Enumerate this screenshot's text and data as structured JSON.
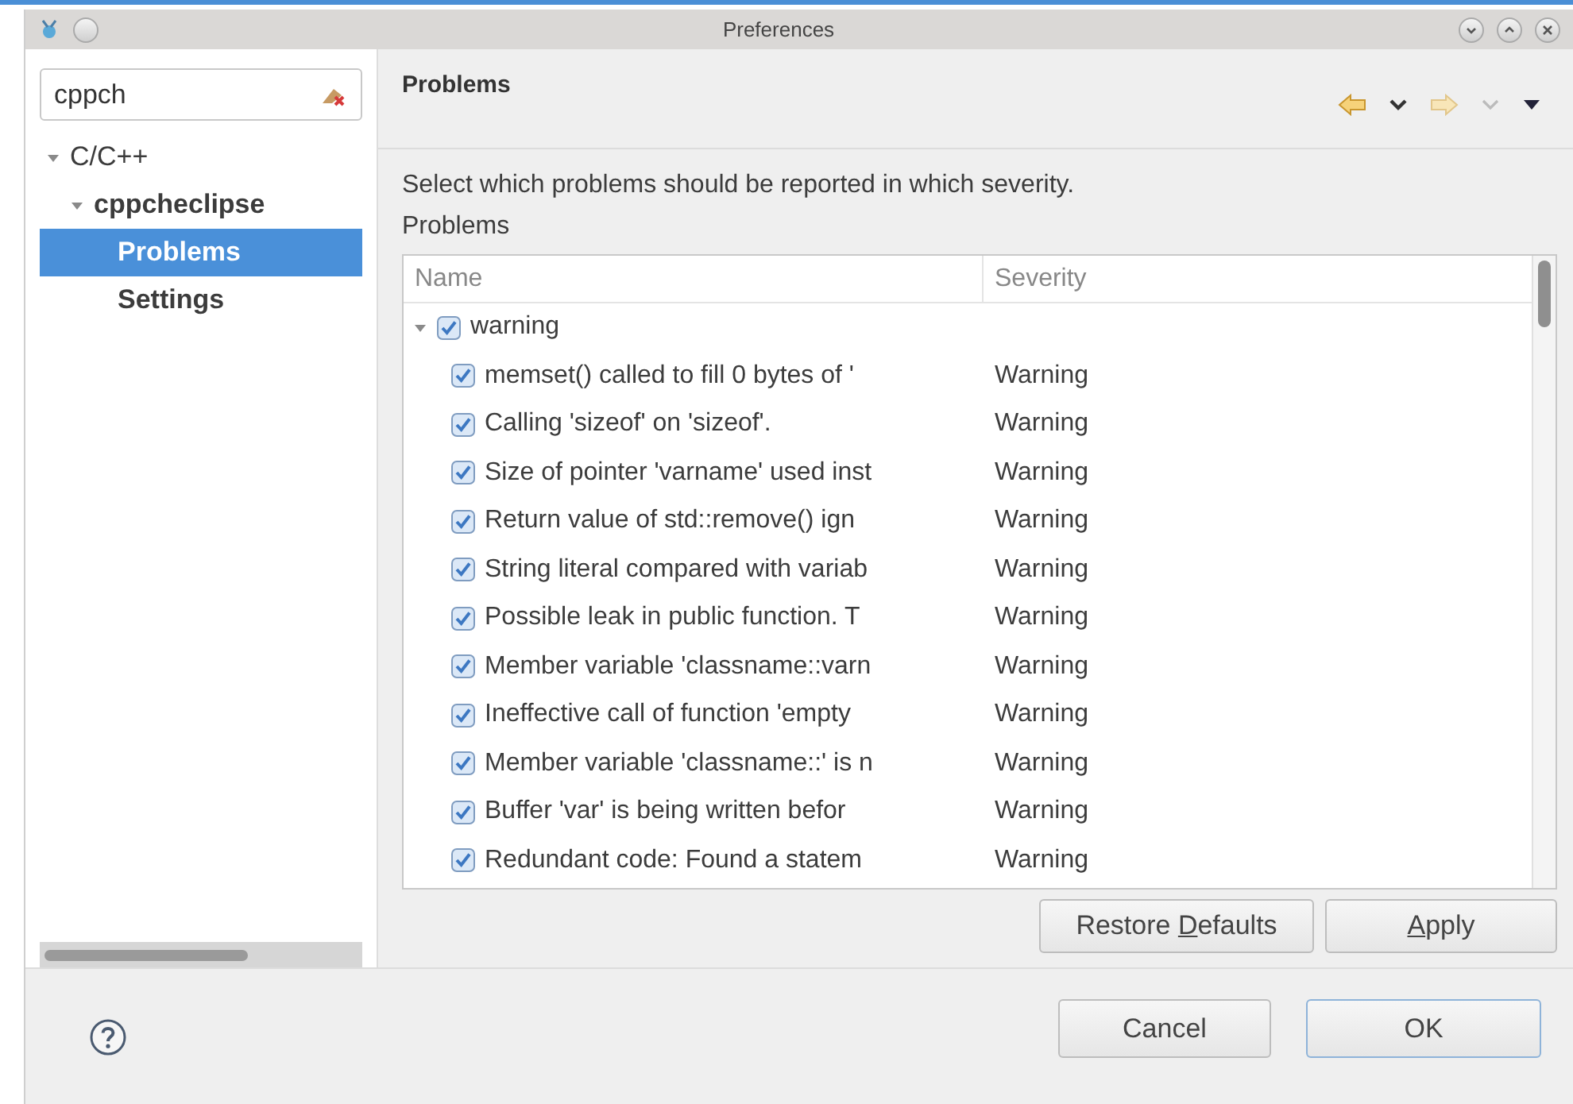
{
  "window": {
    "title": "Preferences"
  },
  "filter": {
    "value": "cppch"
  },
  "sidebar": {
    "items": [
      {
        "label": "C/C++",
        "expanded": true,
        "selected": false,
        "children": [
          {
            "label": "cppcheclipse",
            "expanded": true,
            "selected": false,
            "children": [
              {
                "label": "Problems",
                "selected": true
              },
              {
                "label": "Settings",
                "selected": false
              }
            ]
          }
        ]
      }
    ]
  },
  "page": {
    "title": "Problems",
    "description": "Select which problems should be reported in which severity.",
    "group_label": "Problems"
  },
  "table": {
    "columns": [
      "Name",
      "Severity"
    ],
    "rows": [
      {
        "name": "warning",
        "expanded": true,
        "checked": true,
        "children": [
          {
            "name": "memset() called to fill 0 bytes of '",
            "severity": "Warning",
            "checked": true
          },
          {
            "name": "Calling 'sizeof' on 'sizeof'.",
            "severity": "Warning",
            "checked": true
          },
          {
            "name": "Size of pointer 'varname' used inst",
            "severity": "Warning",
            "checked": true
          },
          {
            "name": "Return value of std::remove() ign",
            "severity": "Warning",
            "checked": true
          },
          {
            "name": "String literal compared with variab",
            "severity": "Warning",
            "checked": true
          },
          {
            "name": "Possible leak in public function. T",
            "severity": "Warning",
            "checked": true
          },
          {
            "name": "Member variable 'classname::varn",
            "severity": "Warning",
            "checked": true
          },
          {
            "name": "Ineffective call of function 'empty",
            "severity": "Warning",
            "checked": true
          },
          {
            "name": "Member variable 'classname::' is n",
            "severity": "Warning",
            "checked": true
          },
          {
            "name": "Buffer 'var' is being written befor",
            "severity": "Warning",
            "checked": true
          },
          {
            "name": "Redundant code: Found a statem",
            "severity": "Warning",
            "checked": true
          }
        ]
      }
    ]
  },
  "page_buttons": [
    {
      "label_before": "Restore ",
      "access_key": "D",
      "label_after": "efaults"
    },
    {
      "access_key": "A",
      "label_after": "pply"
    }
  ],
  "dialog_buttons": [
    {
      "label": "Cancel",
      "default": false
    },
    {
      "label": "OK",
      "default": true
    }
  ]
}
